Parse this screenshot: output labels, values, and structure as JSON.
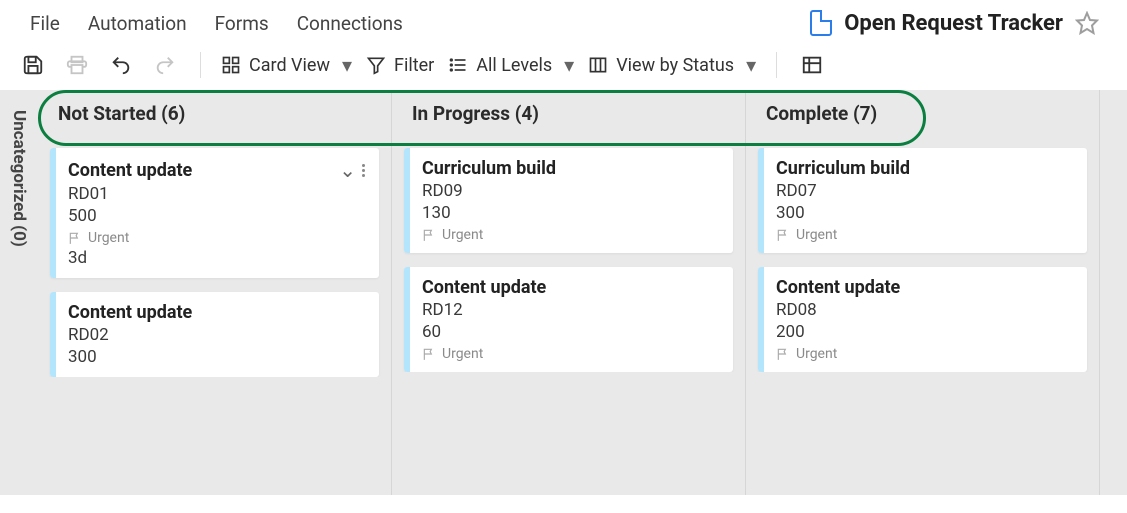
{
  "menu": {
    "file": "File",
    "automation": "Automation",
    "forms": "Forms",
    "connections": "Connections"
  },
  "pageTitle": "Open Request Tracker",
  "toolbar": {
    "cardView": "Card View",
    "filter": "Filter",
    "levels": "All Levels",
    "viewBy": "View by Status"
  },
  "sidebar": {
    "uncategorized": "Uncategorized (0)"
  },
  "columns": [
    {
      "header": "Not Started (6)",
      "cards": [
        {
          "title": "Content update",
          "id": "RD01",
          "value": "500",
          "tag": "Urgent",
          "extra": "3d",
          "showMenu": true
        },
        {
          "title": "Content update",
          "id": "RD02",
          "value": "300"
        }
      ]
    },
    {
      "header": "In Progress (4)",
      "cards": [
        {
          "title": "Curriculum build",
          "id": "RD09",
          "value": "130",
          "tag": "Urgent"
        },
        {
          "title": "Content update",
          "id": "RD12",
          "value": "60",
          "tag": "Urgent"
        }
      ]
    },
    {
      "header": "Complete (7)",
      "cards": [
        {
          "title": "Curriculum build",
          "id": "RD07",
          "value": "300",
          "tag": "Urgent"
        },
        {
          "title": "Content update",
          "id": "RD08",
          "value": "200",
          "tag": "Urgent"
        }
      ]
    }
  ]
}
